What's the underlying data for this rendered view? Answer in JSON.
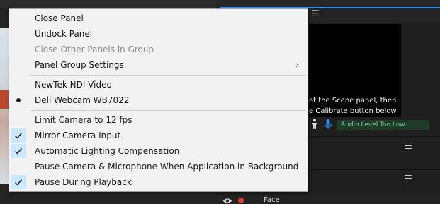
{
  "menu": {
    "items": [
      {
        "label": "Close Panel"
      },
      {
        "label": "Undock Panel"
      },
      {
        "label": "Close Other Panels in Group"
      },
      {
        "label": "Panel Group Settings",
        "submenu_arrow": "›"
      },
      {
        "label": "NewTek NDI Video"
      },
      {
        "label": "Dell Webcam WB7022"
      },
      {
        "label": "Limit Camera to 12 fps"
      },
      {
        "label": "Mirror Camera Input"
      },
      {
        "label": "Automatic Lighting Compensation"
      },
      {
        "label": "Pause Camera & Microphone When Application in Background"
      },
      {
        "label": "Pause During Playback"
      }
    ]
  },
  "panel": {
    "instructions_line1": "at the Scene panel, then",
    "instructions_line2": "e Calibrate button below",
    "audio_status": "Audio Level Too Low",
    "layer_name": "Face"
  },
  "colors": {
    "accent": "#2d8ceb",
    "check_highlight": "#cce8ff",
    "audio_badge_bg": "#1e3a28",
    "audio_badge_text": "#7fc59a",
    "record": "#e53b3b",
    "mic": "#2d8ceb"
  }
}
